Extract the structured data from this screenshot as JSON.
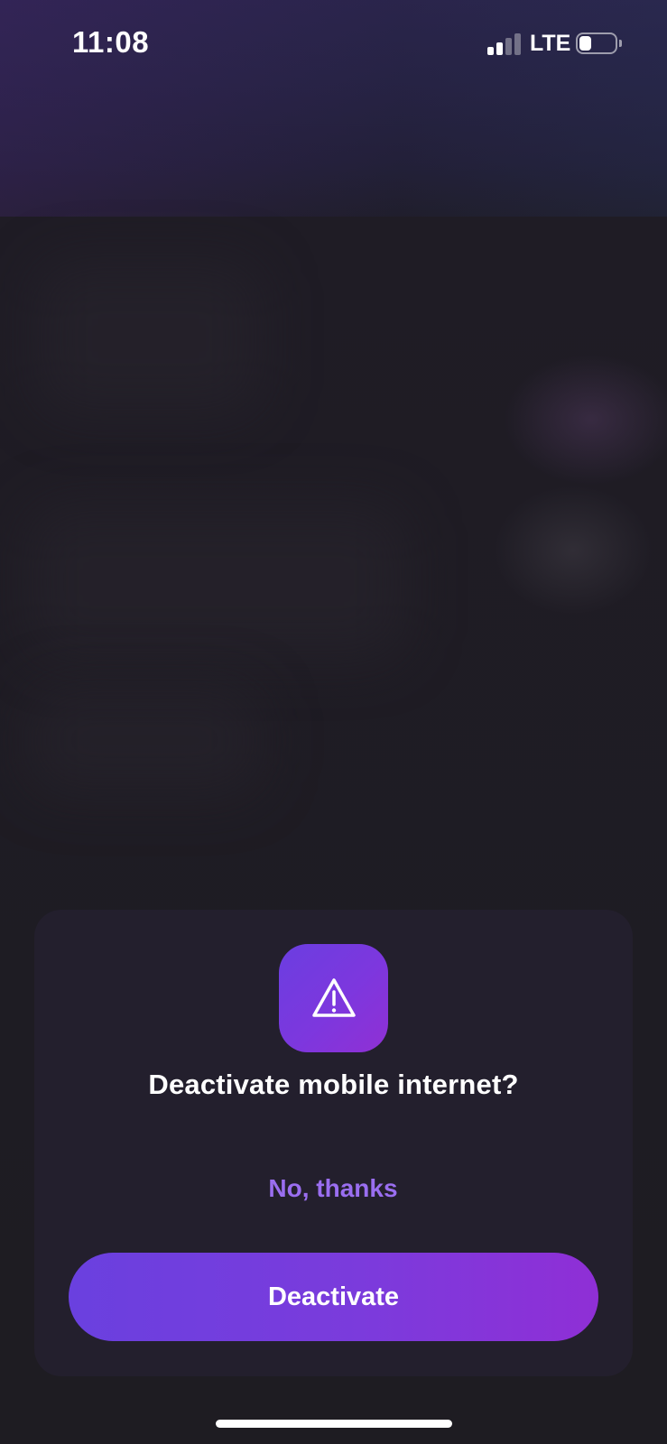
{
  "status_bar": {
    "time": "11:08",
    "network": "LTE",
    "signal_bars_active": 2,
    "signal_bars_total": 4,
    "battery_level": 0.35
  },
  "dialog": {
    "icon": "warning-triangle-icon",
    "title": "Deactivate mobile internet?",
    "secondary_label": "No, thanks",
    "primary_label": "Deactivate"
  },
  "colors": {
    "accent": "#7b3bdc",
    "accent_text": "#9a6ef0",
    "sheet_background": "#231f2d",
    "screen_background": "#1e1c22"
  }
}
